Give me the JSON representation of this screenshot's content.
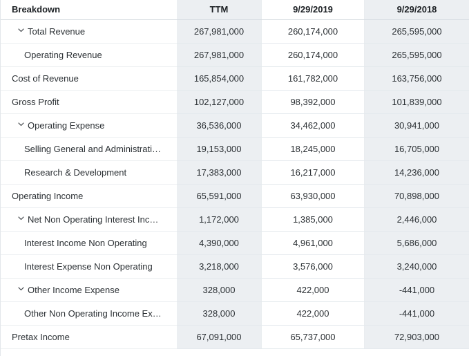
{
  "table": {
    "columns": [
      {
        "key": "breakdown",
        "label": "Breakdown",
        "align": "left"
      },
      {
        "key": "ttm",
        "label": "TTM",
        "align": "center"
      },
      {
        "key": "fy2019",
        "label": "9/29/2019",
        "align": "center"
      },
      {
        "key": "fy2018",
        "label": "9/29/2018",
        "align": "center"
      }
    ],
    "colors": {
      "shaded_column_bg": "#eceff2",
      "plain_column_bg": "#ffffff",
      "header_border": "#d7dde2",
      "row_border": "#eceff1",
      "text": "#2b3034",
      "header_text": "#1b1f23"
    },
    "rows": [
      {
        "label": "Total Revenue",
        "indent": 1,
        "expandable": true,
        "icon": "chevron-down-icon",
        "truncated": false,
        "ttm": "267,981,000",
        "fy2019": "260,174,000",
        "fy2018": "265,595,000"
      },
      {
        "label": "Operating Revenue",
        "indent": 2,
        "expandable": false,
        "icon": "",
        "truncated": false,
        "ttm": "267,981,000",
        "fy2019": "260,174,000",
        "fy2018": "265,595,000"
      },
      {
        "label": "Cost of Revenue",
        "indent": 0,
        "expandable": false,
        "icon": "",
        "truncated": false,
        "ttm": "165,854,000",
        "fy2019": "161,782,000",
        "fy2018": "163,756,000"
      },
      {
        "label": "Gross Profit",
        "indent": 0,
        "expandable": false,
        "icon": "",
        "truncated": false,
        "ttm": "102,127,000",
        "fy2019": "98,392,000",
        "fy2018": "101,839,000"
      },
      {
        "label": "Operating Expense",
        "indent": 1,
        "expandable": true,
        "icon": "chevron-down-icon",
        "truncated": false,
        "ttm": "36,536,000",
        "fy2019": "34,462,000",
        "fy2018": "30,941,000"
      },
      {
        "label": "Selling General and Administrati…",
        "indent": 2,
        "expandable": false,
        "icon": "",
        "truncated": true,
        "ttm": "19,153,000",
        "fy2019": "18,245,000",
        "fy2018": "16,705,000"
      },
      {
        "label": "Research & Development",
        "indent": 2,
        "expandable": false,
        "icon": "",
        "truncated": false,
        "ttm": "17,383,000",
        "fy2019": "16,217,000",
        "fy2018": "14,236,000"
      },
      {
        "label": "Operating Income",
        "indent": 0,
        "expandable": false,
        "icon": "",
        "truncated": false,
        "ttm": "65,591,000",
        "fy2019": "63,930,000",
        "fy2018": "70,898,000"
      },
      {
        "label": "Net Non Operating Interest Inc…",
        "indent": 1,
        "expandable": true,
        "icon": "chevron-down-icon",
        "truncated": true,
        "ttm": "1,172,000",
        "fy2019": "1,385,000",
        "fy2018": "2,446,000"
      },
      {
        "label": "Interest Income Non Operating",
        "indent": 2,
        "expandable": false,
        "icon": "",
        "truncated": false,
        "ttm": "4,390,000",
        "fy2019": "4,961,000",
        "fy2018": "5,686,000"
      },
      {
        "label": "Interest Expense Non Operating",
        "indent": 2,
        "expandable": false,
        "icon": "",
        "truncated": false,
        "ttm": "3,218,000",
        "fy2019": "3,576,000",
        "fy2018": "3,240,000"
      },
      {
        "label": "Other Income Expense",
        "indent": 1,
        "expandable": true,
        "icon": "chevron-down-icon",
        "truncated": false,
        "ttm": "328,000",
        "fy2019": "422,000",
        "fy2018": "-441,000"
      },
      {
        "label": "Other Non Operating Income Ex…",
        "indent": 2,
        "expandable": false,
        "icon": "",
        "truncated": true,
        "ttm": "328,000",
        "fy2019": "422,000",
        "fy2018": "-441,000"
      },
      {
        "label": "Pretax Income",
        "indent": 0,
        "expandable": false,
        "icon": "",
        "truncated": false,
        "ttm": "67,091,000",
        "fy2019": "65,737,000",
        "fy2018": "72,903,000"
      }
    ]
  }
}
